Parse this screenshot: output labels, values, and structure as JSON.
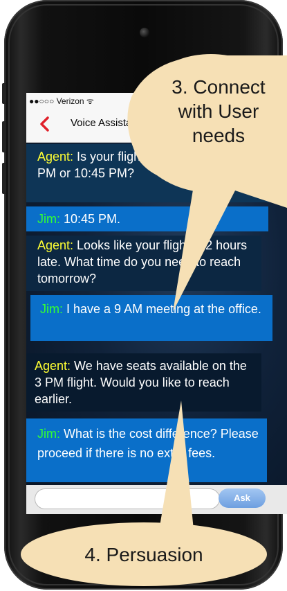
{
  "status_bar": {
    "text": "●●○○○ Verizon ᯤ"
  },
  "nav": {
    "title": "Voice Assistant",
    "back_icon": "chevron-left-icon",
    "accent": "#e0202a"
  },
  "messages": [
    {
      "speaker": "Agent:",
      "text": " Is your flight from Los Angeles at 3 PM or 10:45 PM?"
    },
    {
      "speaker": "Jim:",
      "text": " 10:45 PM."
    },
    {
      "speaker": "Agent:",
      "text": " Looks like your flight is 2 hours late. What time do you need to reach tomorrow?"
    },
    {
      "speaker": "Jim:",
      "text": " I have a 9 AM meeting at the office."
    },
    {
      "speaker": "Agent:",
      "text": " We have seats available on the 3 PM flight.  Would you like to reach earlier."
    },
    {
      "speaker": "Jim:",
      "text": " What is the cost difference? Please proceed if there is no extra fees."
    }
  ],
  "input": {
    "placeholder": "",
    "ask_label": "Ask"
  },
  "callouts": {
    "connect": [
      "3. Connect",
      "with User",
      "needs"
    ],
    "persuasion": "4. Persuasion"
  },
  "colors": {
    "agent_label": "#ffff33",
    "jim_label": "#33ff33",
    "jim_bubble": "#0a6fc9",
    "callout": "#f6e0b5"
  }
}
